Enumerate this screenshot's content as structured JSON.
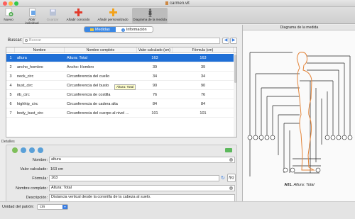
{
  "window": {
    "title": "carmen.vit"
  },
  "toolbar": {
    "buttons": [
      {
        "label": "Nuevo"
      },
      {
        "label": "Abrir individual"
      },
      {
        "label": "Guardar"
      },
      {
        "label": "Añadir conocido"
      },
      {
        "label": "Añadir personalizado"
      },
      {
        "label": "Diagrama de la medida"
      }
    ]
  },
  "tabs": {
    "measures": "Medidas",
    "information": "Información"
  },
  "search": {
    "label": "Buscar:",
    "placeholder": "Buscar"
  },
  "table": {
    "headers": [
      "Nombre",
      "Nombre completo",
      "Valor calculado (cm)",
      "Fórmula (cm)"
    ],
    "rows": [
      {
        "n": "1",
        "name": "altura",
        "full": "Altura: Total",
        "calc": "163",
        "formula": "163"
      },
      {
        "n": "2",
        "name": "ancho_hombro",
        "full": "Ancho: Hombro",
        "calc": "39",
        "formula": "39"
      },
      {
        "n": "3",
        "name": "neck_circ",
        "full": "Circunferencia del cuello",
        "calc": "34",
        "formula": "34"
      },
      {
        "n": "4",
        "name": "bust_circ",
        "full": "Circunferencia del busto",
        "calc": "90",
        "formula": "90"
      },
      {
        "n": "5",
        "name": "rib_circ",
        "full": "Circunferencia de costilla",
        "calc": "76",
        "formula": "76"
      },
      {
        "n": "6",
        "name": "highhip_circ",
        "full": "Circunferencia de cadera alta",
        "calc": "84",
        "formula": "84"
      },
      {
        "n": "7",
        "name": "body_bust_circ",
        "full": "Circunferencia del cuerpo al nivel ...",
        "calc": "101",
        "formula": "101"
      }
    ],
    "tooltip": "Altura: Total"
  },
  "details": {
    "section_label": "Detalles",
    "name_label": "Nombre:",
    "name_value": "altura",
    "calc_label": "Valor calculado:",
    "calc_value": "163 cm",
    "formula_label": "Fórmula:",
    "formula_value": "163",
    "fullname_label": "Nombre completo:",
    "fullname_value": "Altura: Total",
    "description_label": "Descripción:",
    "description_value": "Distancia vertical desde la coronilla de la cabeza al suelo."
  },
  "statusbar": {
    "unit_label": "Unidad del patrón:",
    "unit_value": "cm"
  },
  "diagram": {
    "header": "Diagrama de la medida",
    "code": "A01.",
    "title": "Altura: Total"
  }
}
